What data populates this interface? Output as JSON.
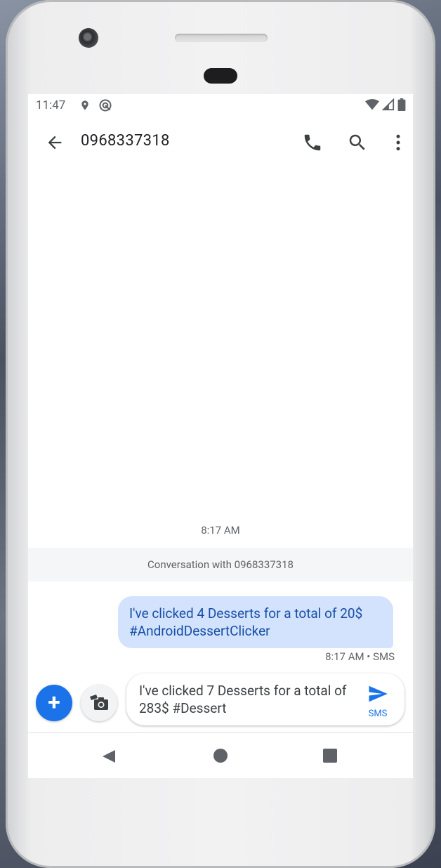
{
  "status_bar": {
    "time": "11:47"
  },
  "toolbar": {
    "title": "0968337318"
  },
  "conversation": {
    "timestamp": "8:17 AM",
    "banner": "Conversation with 0968337318",
    "messages": [
      {
        "text": "I've clicked 4 Desserts for a total of 20$ #AndroidDessertClicker",
        "meta": "8:17 AM • SMS"
      }
    ]
  },
  "compose": {
    "value": "I've clicked 7 Desserts for a total of 283$ #Dessert",
    "send_label": "SMS",
    "attach_label": "+"
  },
  "colors": {
    "accent": "#1a73e8",
    "bubble": "#d3e3fd",
    "bubble_text": "#174ea6"
  }
}
